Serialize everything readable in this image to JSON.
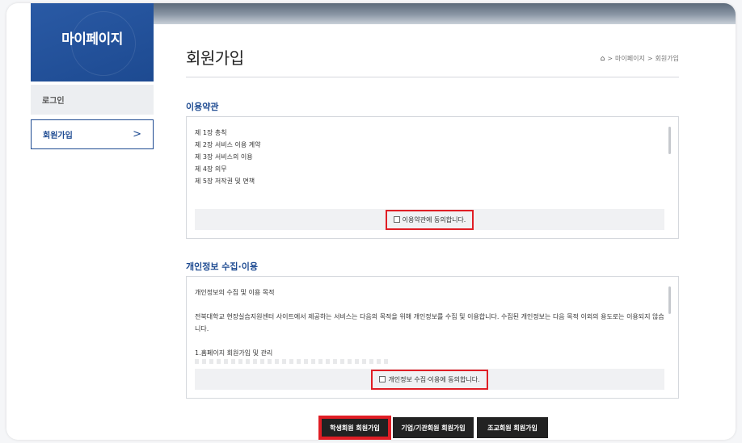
{
  "sidebar": {
    "title": "마이페이지",
    "items": [
      {
        "label": "로그인"
      },
      {
        "label": "회원가입",
        "arrow": ">"
      }
    ]
  },
  "header": {
    "title": "회원가입",
    "breadcrumb": {
      "home_icon": "home-icon",
      "sep1": ">",
      "level1": "마이페이지",
      "sep2": ">",
      "level2": "회원가입"
    }
  },
  "terms": {
    "section_title": "이용약관",
    "lines": [
      "제 1장 총칙",
      "제 2장 서비스 이용 계약",
      "제 3장 서비스의 이용",
      "제 4장 의무",
      "제 5장 저작권 및 면책"
    ],
    "agree_label": "이용약관에 동의합니다."
  },
  "privacy": {
    "section_title": "개인정보 수집·이용",
    "paragraphs": [
      "개인정보의 수집 및 이용 목적",
      "전북대학교 현장실습지원센터 사이트에서 제공하는 서비스는 다음의 목적을 위해 개인정보를 수집 및 이용합니다. 수집된 개인정보는 다음 목적 이외의 용도로는 이용되지 않습니다.",
      "1.홈페이지 회원가입 및 관리"
    ],
    "agree_label": "개인정보 수집·이용에 동의합니다."
  },
  "buttons": {
    "student": "학생회원 회원가입",
    "company": "기업/기관회원 회원가입",
    "school": "조교회원 회원가입"
  },
  "colors": {
    "brand_blue": "#1d4a91",
    "highlight_red": "#e01e25",
    "button_dark": "#222222"
  }
}
